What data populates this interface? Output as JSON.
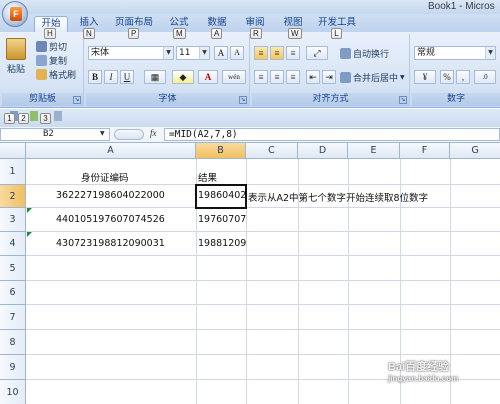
{
  "window": {
    "title": "Book1 - Micros"
  },
  "tabs": [
    {
      "label": "开始",
      "keytip": "H",
      "active": true
    },
    {
      "label": "插入",
      "keytip": "N"
    },
    {
      "label": "页面布局",
      "keytip": "P"
    },
    {
      "label": "公式",
      "keytip": "M"
    },
    {
      "label": "数据",
      "keytip": "A"
    },
    {
      "label": "审阅",
      "keytip": "R"
    },
    {
      "label": "视图",
      "keytip": "W"
    },
    {
      "label": "开发工具",
      "keytip": "L"
    }
  ],
  "ribbon": {
    "clipboard": {
      "label": "剪贴板",
      "paste": "粘贴",
      "cut": "剪切",
      "copy": "复制",
      "format_painter": "格式刷"
    },
    "font": {
      "label": "字体",
      "name": "宋体",
      "size": "11",
      "grow": "A",
      "shrink": "A",
      "bold": "B",
      "italic": "I",
      "underline": "U",
      "font_color": "A",
      "phonetic": "wén"
    },
    "alignment": {
      "label": "对齐方式",
      "wrap": "自动换行",
      "merge": "合并后居中"
    },
    "number": {
      "label": "数字",
      "format": "常规",
      "percent": "%",
      "comma": ","
    }
  },
  "qat": {
    "keytips": [
      "1",
      "2",
      "3"
    ]
  },
  "formula_bar": {
    "name_box": "B2",
    "fx": "fx",
    "formula": "=MID(A2,7,8)"
  },
  "grid": {
    "columns": [
      "A",
      "B",
      "C",
      "D",
      "E",
      "F",
      "G"
    ],
    "rows": [
      "1",
      "2",
      "3",
      "4",
      "5",
      "6",
      "7",
      "8",
      "9",
      "10"
    ],
    "cells": {
      "A1": "身份证编码",
      "B1": "结果",
      "A2": "362227198604022000",
      "B2": "19860402",
      "C2": "表示从A2中第七个数字开始连续取8位数字",
      "A3": "440105197607074526",
      "B3": "19760707",
      "A4": "430723198812090031",
      "B4": "19881209"
    }
  },
  "watermark": {
    "line1": "Bai百度经验",
    "line2": "jingyan.baidu.com"
  }
}
